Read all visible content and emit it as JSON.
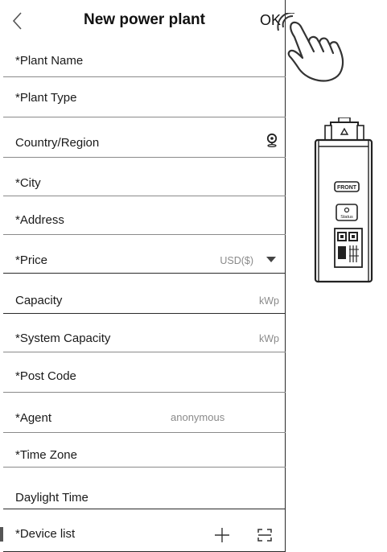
{
  "header": {
    "title": "New power plant",
    "ok_label": "OK",
    "back_icon": "chevron-left-icon"
  },
  "fields": {
    "plant_name": "*Plant Name",
    "plant_type": "*Plant Type",
    "country_region": "Country/Region",
    "city": "*City",
    "address": "*Address",
    "price": "*Price",
    "price_currency": "USD($)",
    "capacity": "Capacity",
    "capacity_unit": "kWp",
    "system_capacity": "*System Capacity",
    "system_capacity_unit": "kWp",
    "post_code": "*Post Code",
    "agent": "*Agent",
    "agent_value": "anonymous",
    "time_zone": "*Time Zone",
    "daylight_time": "Daylight Time",
    "device_list": "*Device list"
  },
  "device": {
    "front_label": "FRONT",
    "status_label": "Status"
  },
  "icons": {
    "location": "location-pin-icon",
    "dropdown": "caret-down-icon",
    "add": "plus-icon",
    "scan": "scan-icon",
    "pointer": "hand-pointer-icon"
  }
}
